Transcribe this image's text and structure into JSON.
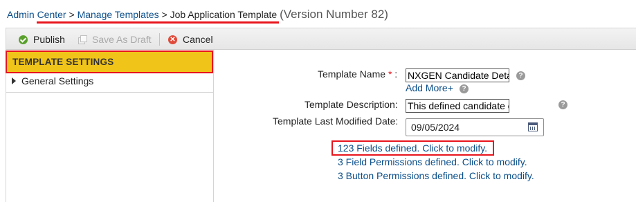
{
  "breadcrumb": {
    "admin_center": "Admin Center",
    "sep1": ">",
    "manage_templates": "Manage Templates",
    "sep2": ">",
    "current": "Job Application Template",
    "version": "(Version Number 82)"
  },
  "toolbar": {
    "publish_label": "Publish",
    "save_draft_label": "Save As Draft",
    "cancel_label": "Cancel",
    "publish_icon": "check-circle-icon",
    "save_draft_icon": "copy-icon",
    "cancel_icon": "cancel-circle-icon"
  },
  "sidebar": {
    "header": "TEMPLATE SETTINGS",
    "items": [
      {
        "label": "General Settings",
        "expanded": false
      }
    ]
  },
  "form": {
    "template_name": {
      "label": "Template Name",
      "required_mark": "*",
      "colon": ":",
      "value": "NXGEN Candidate Deta",
      "add_more": "Add More+"
    },
    "template_description": {
      "label": "Template Description:",
      "value": "This defined candidate o"
    },
    "last_modified": {
      "label": "Template Last Modified Date:",
      "value": "09/05/2024"
    },
    "help_glyph": "?",
    "links": {
      "fields": "123 Fields defined. Click to modify.",
      "field_permissions": "3 Field Permissions defined. Click to modify.",
      "button_permissions": "3 Button Permissions defined. Click to modify."
    }
  },
  "colors": {
    "link": "#0a4e8a",
    "highlight_border": "#e8141c",
    "settings_header_bg": "#f0c419"
  }
}
